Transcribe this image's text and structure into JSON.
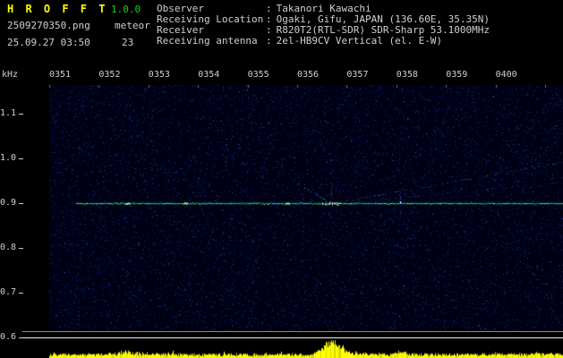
{
  "app": {
    "title": "H R O F F T",
    "version": "1.0.0",
    "filename": "2509270350.png",
    "mode": "meteor",
    "datetime": "25.09.27 03:50",
    "count": "23"
  },
  "station": {
    "separator": ":",
    "rows": [
      {
        "label": "Observer",
        "value": "Takanori Kawachi"
      },
      {
        "label": "Receiving Location",
        "value": "Ogaki, Gifu, JAPAN (136.60E, 35.35N)"
      },
      {
        "label": "Receiver",
        "value": "R820T2(RTL-SDR) SDR-Sharp 53.1000MHz"
      },
      {
        "label": "Receiving antenna",
        "value": "2el-HB9CV Vertical (el. E-W)"
      }
    ]
  },
  "axes": {
    "freq_unit": "kHz",
    "freq_ticks": [
      "1.1",
      "1.0",
      "0.9",
      "0.8",
      "0.7",
      "0.6"
    ],
    "time_ticks": [
      "0351",
      "0352",
      "0353",
      "0354",
      "0355",
      "0356",
      "0357",
      "0358",
      "0359",
      "0400"
    ]
  },
  "spectrogram": {
    "background": "#000014",
    "noise_color": "#1e3cdc",
    "trace_freq_khz": "0.9",
    "trace_colors": [
      "#00c860",
      "#00e6e6",
      "#a0ffc8"
    ],
    "event": {
      "time_label": "0356",
      "time_frac": 0.549,
      "color": "#ff64ff"
    },
    "spike": {
      "time_frac": 0.683,
      "color": "#ffffff"
    },
    "seed": 42
  },
  "level_graph": {
    "bar_color": "#ffff00",
    "bar_color_dim": "#d8d800",
    "peak_time_frac": 0.549
  },
  "colors": {
    "background": "#000000",
    "title": "#ffff00",
    "version": "#00dd00",
    "text": "#d0d0d0",
    "separator_upper": "#8a8a9a",
    "separator_lower": "#f0f0f0"
  }
}
